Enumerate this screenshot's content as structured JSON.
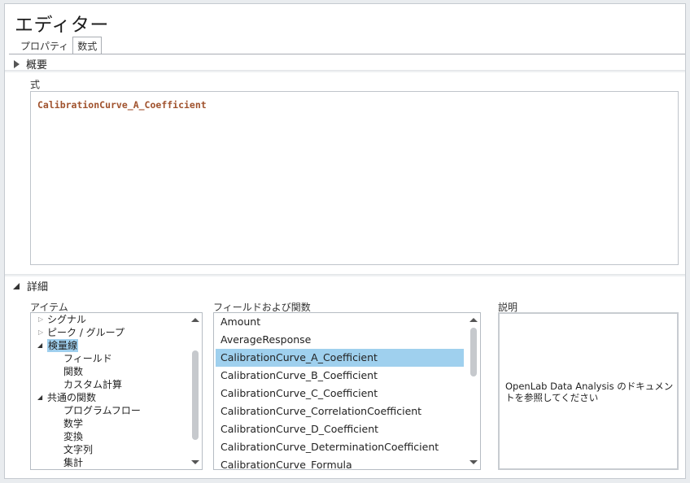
{
  "window": {
    "title": "エディター"
  },
  "tabs": [
    {
      "label": "プロパティ",
      "active": false
    },
    {
      "label": "数式",
      "active": true
    }
  ],
  "overview": {
    "label": "概要",
    "expanded": false
  },
  "formula": {
    "label": "式",
    "value": "CalibrationCurve_A_Coefficient"
  },
  "details": {
    "label": "詳細",
    "expanded": true
  },
  "items_panel": {
    "label": "アイテム",
    "tree": [
      {
        "label": "シグナル",
        "level": 0,
        "expander": "collapsed"
      },
      {
        "label": "ピーク / グループ",
        "level": 0,
        "expander": "collapsed"
      },
      {
        "label": "検量線",
        "level": 0,
        "expander": "expanded",
        "selected": true
      },
      {
        "label": "フィールド",
        "level": 1
      },
      {
        "label": "関数",
        "level": 1
      },
      {
        "label": "カスタム計算",
        "level": 1
      },
      {
        "label": "共通の関数",
        "level": 0,
        "expander": "expanded"
      },
      {
        "label": "プログラムフロー",
        "level": 1
      },
      {
        "label": "数学",
        "level": 1
      },
      {
        "label": "変換",
        "level": 1
      },
      {
        "label": "文字列",
        "level": 1
      },
      {
        "label": "集計",
        "level": 1
      }
    ]
  },
  "fields_panel": {
    "label": "フィールドおよび関数",
    "items": [
      "Amount",
      "AverageResponse",
      "CalibrationCurve_A_Coefficient",
      "CalibrationCurve_B_Coefficient",
      "CalibrationCurve_C_Coefficient",
      "CalibrationCurve_CorrelationCoefficient",
      "CalibrationCurve_D_Coefficient",
      "CalibrationCurve_DeterminationCoefficient",
      "CalibrationCurve_Formula"
    ],
    "selected_index": 2
  },
  "description_panel": {
    "label": "説明",
    "text": "OpenLab Data Analysis のドキュメントを参照してください"
  },
  "colors": {
    "selection": "#9fd0ee",
    "formula_text": "#a0522d"
  }
}
